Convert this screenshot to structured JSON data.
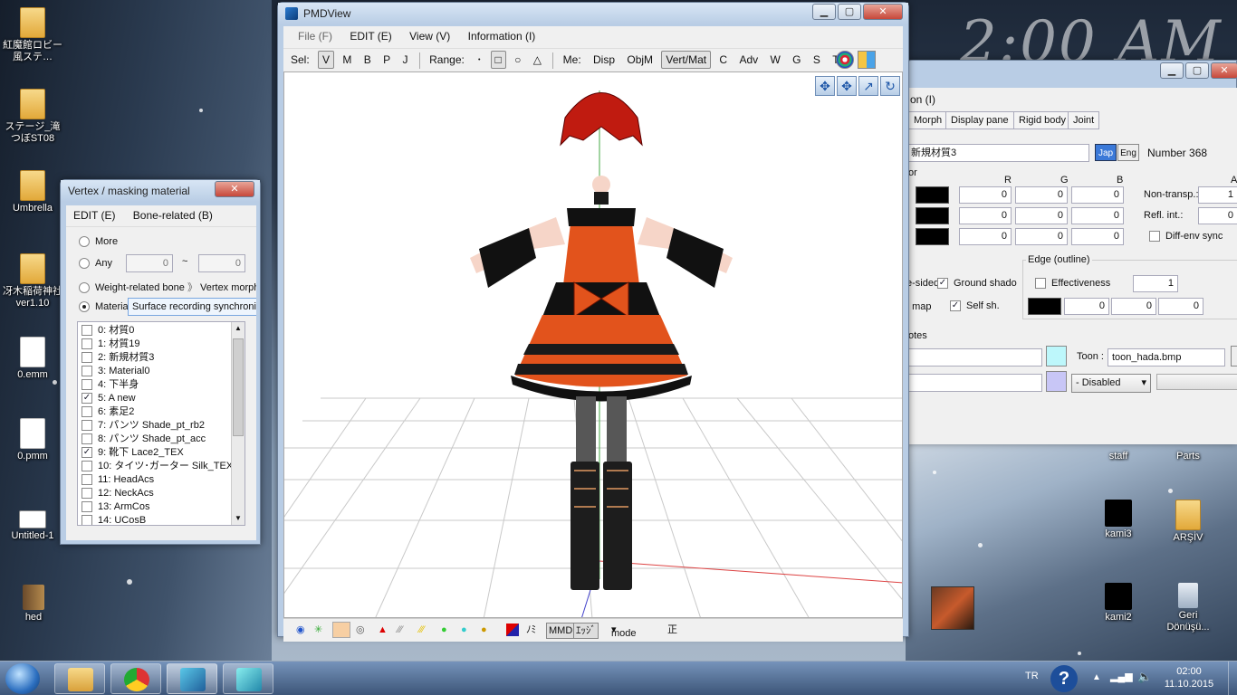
{
  "desktop": {
    "clock_overlay": "2:00 AM",
    "icons_left": [
      {
        "label": "紅魔館ロビー風ステ…",
        "type": "folder"
      },
      {
        "label": "ステージ_滝つぼST08",
        "type": "folder"
      },
      {
        "label": "Umbrella",
        "type": "folder"
      },
      {
        "label": "冴木稲荷神社 ver1.10",
        "type": "folder"
      },
      {
        "label": "0.emm",
        "type": "file"
      },
      {
        "label": "0.pmm",
        "type": "file"
      },
      {
        "label": "Untitled-1",
        "type": "file"
      },
      {
        "label": "hed",
        "type": "book"
      }
    ],
    "icons_right": [
      {
        "label": "staff"
      },
      {
        "label": "Parts"
      },
      {
        "label": "kami3"
      },
      {
        "label": "ARŞİV"
      },
      {
        "label": "kami2"
      },
      {
        "label": "Geri Dönüşü..."
      }
    ]
  },
  "pmdview": {
    "title": "PMDView",
    "menu": [
      "File (F)",
      "EDIT (E)",
      "View (V)",
      "Information (I)"
    ],
    "toolbar": {
      "sel_label": "Sel:",
      "sel_items": [
        "V",
        "M",
        "B",
        "P",
        "J"
      ],
      "range_label": "Range:",
      "range_items": [
        "･",
        "□",
        "○",
        "△"
      ],
      "me_label": "Me:",
      "me_items": [
        "Disp",
        "ObjM",
        "Vert/Mat",
        "C",
        "Adv",
        "W",
        "G",
        "S",
        "T"
      ]
    },
    "bottom": {
      "mode_label": "mode",
      "right_glyph": "正",
      "glyph_a": "ﾉﾐ",
      "glyph_b": "ｴｯｼﾞ"
    }
  },
  "vertex_window": {
    "title": "Vertex / masking material",
    "menu": [
      "EDIT (E)",
      "Bone-related (B)"
    ],
    "options": {
      "more": "More",
      "any": "Any",
      "any_from": "0",
      "any_sep": "~",
      "any_to": "0",
      "weight_bone": "Weight-related bone",
      "sep": "》",
      "vertex_morph": "Vertex morph",
      "material": "Materia",
      "material_value": "Surface recording synchronizi"
    },
    "materials": [
      {
        "label": "0: 材質0",
        "checked": false
      },
      {
        "label": "1: 材質19",
        "checked": false
      },
      {
        "label": "2: 新規材質3",
        "checked": false
      },
      {
        "label": "3: Material0",
        "checked": false
      },
      {
        "label": "4: 下半身",
        "checked": false
      },
      {
        "label": "5: A new",
        "checked": true
      },
      {
        "label": "6: 素足2",
        "checked": false
      },
      {
        "label": "7: パンツ Shade_pt_rb2",
        "checked": false
      },
      {
        "label": "8: パンツ Shade_pt_acc",
        "checked": false
      },
      {
        "label": "9: 靴下 Lace2_TEX",
        "checked": true
      },
      {
        "label": "10: タイツ･ガーター Silk_TEX",
        "checked": false
      },
      {
        "label": "11: HeadAcs",
        "checked": false
      },
      {
        "label": "12: NeckAcs",
        "checked": false
      },
      {
        "label": "13: ArmCos",
        "checked": false
      },
      {
        "label": "14: UCosB",
        "checked": false
      }
    ]
  },
  "props_window": {
    "menu_partial": "on (I)",
    "tabs": [
      "Morph",
      "Display pane",
      "Rigid body",
      "Joint"
    ],
    "material_name": "新規材質3",
    "lang_jap": "Jap",
    "lang_eng": "Eng",
    "number_label": "Number 368",
    "color_label": "or",
    "cols": [
      "R",
      "G",
      "B",
      "A"
    ],
    "rows": [
      {
        "r": "0",
        "g": "0",
        "b": "0",
        "label": "Non-transp.:",
        "extra": "1"
      },
      {
        "r": "0",
        "g": "0",
        "b": "0",
        "label": "Refl. int.:",
        "extra": "0"
      },
      {
        "r": "0",
        "g": "0",
        "b": "0",
        "label": "Diff-env sync",
        "extra": ""
      }
    ],
    "flags": {
      "double_sided": "e-sided",
      "ground_shadow": "Ground shado",
      "map": ". map",
      "self_shadow": "Self sh."
    },
    "edge": {
      "title": "Edge (outline)",
      "effectiveness": "Effectiveness",
      "size": "1",
      "values": [
        "0",
        "0",
        "0"
      ]
    },
    "notes_label": "otes",
    "toon_label": "Toon :",
    "toon_value": "toon_hada.bmp",
    "sphere_mode": "- Disabled"
  },
  "taskbar": {
    "lang": "TR",
    "time": "02:00",
    "date": "11.10.2015"
  }
}
